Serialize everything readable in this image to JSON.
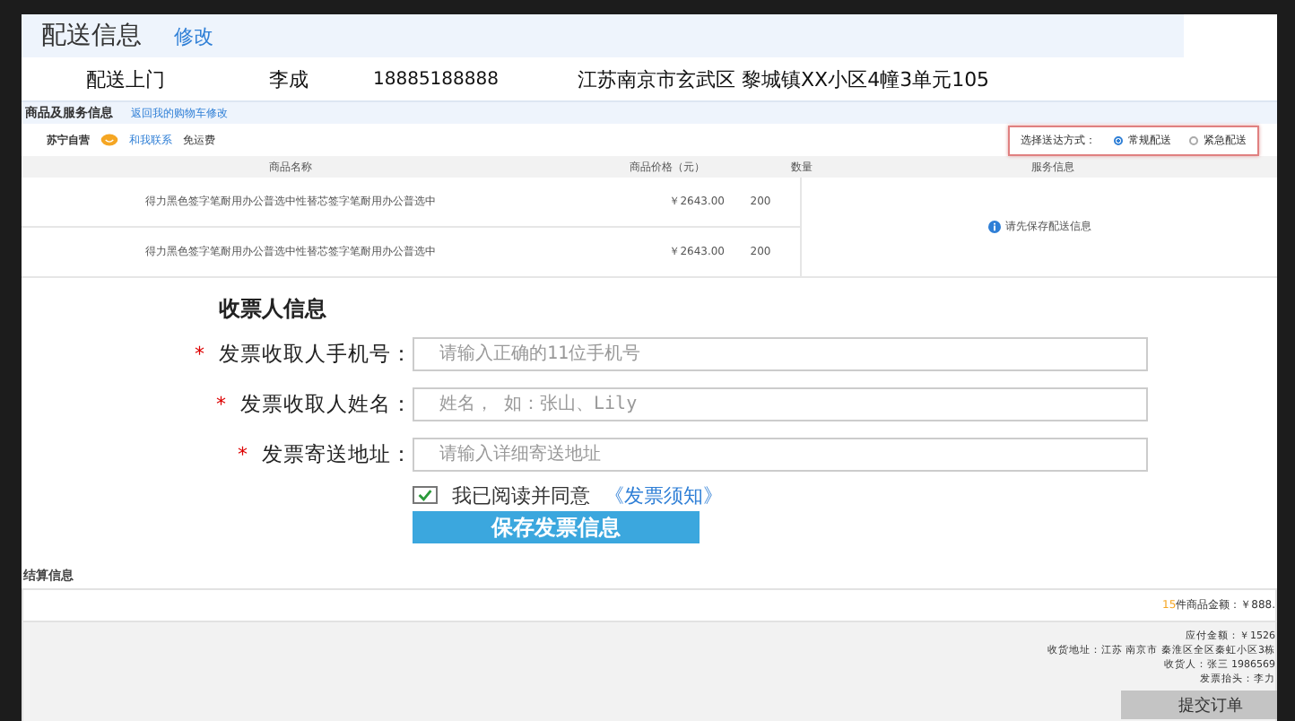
{
  "delivery": {
    "title": "配送信息",
    "edit_link": "修改",
    "method": "配送上门",
    "name": "李成",
    "phone": "18885188888",
    "address": "江苏南京市玄武区 黎城镇XX小区4幢3单元105"
  },
  "goods": {
    "title": "商品及服务信息",
    "back_link": "返回我的购物车修改",
    "store": "苏宁自营",
    "contact": "和我联系",
    "shipping": "免运费",
    "method_label": "选择送达方式：",
    "methods": [
      {
        "label": "常规配送",
        "selected": true
      },
      {
        "label": "紧急配送",
        "selected": false
      }
    ],
    "columns": [
      "商品名称",
      "商品价格（元）",
      "数量",
      "服务信息"
    ],
    "rows": [
      {
        "name": "得力黑色签字笔耐用办公普选中性替芯签字笔耐用办公普选中",
        "price": "￥2643.00",
        "qty": "200"
      },
      {
        "name": "得力黑色签字笔耐用办公普选中性替芯签字笔耐用办公普选中",
        "price": "￥2643.00",
        "qty": "200"
      }
    ],
    "service_note": "请先保存配送信息"
  },
  "invoice": {
    "title": "收票人信息",
    "fields": [
      {
        "label": "发票收取人手机号：",
        "placeholder": "请输入正确的11位手机号",
        "mark": "*"
      },
      {
        "label": "发票收取人姓名：",
        "placeholder": "姓名， 如：张山、Lily",
        "mark": "*"
      },
      {
        "label": "发票寄送地址：",
        "placeholder": "请输入详细寄送地址",
        "mark": "*"
      }
    ],
    "agree": {
      "checked": true,
      "text": "我已阅读并同意",
      "link": "《发票须知》"
    },
    "save_button": "保存发票信息"
  },
  "settlement": {
    "title": "结算信息",
    "count": "15",
    "goods_amount": "件商品金额：￥888.",
    "lines": [
      "应付金额：￥1526",
      "收货地址：江苏 南京市 秦淮区全区秦虹小区3栋",
      "收货人：张三 1986569",
      "发票抬头：李力"
    ],
    "submit_button": "提交订单"
  }
}
